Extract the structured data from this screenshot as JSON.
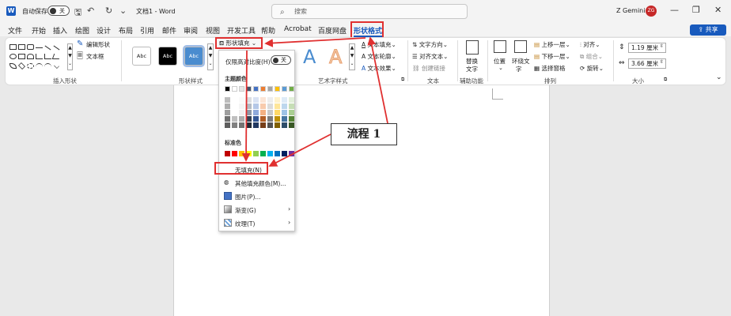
{
  "titlebar": {
    "logo": "W",
    "autosave_label": "自动保存",
    "autosave_state": "关",
    "doc_title": "文档1 - Word",
    "search_placeholder": "搜索",
    "user_name": "Z Gemini",
    "user_initials": "ZG",
    "icons": [
      "save-icon",
      "undo-icon",
      "redo-icon",
      "customize-icon"
    ]
  },
  "tabs": [
    "文件",
    "开始",
    "插入",
    "绘图",
    "设计",
    "布局",
    "引用",
    "邮件",
    "审阅",
    "视图",
    "开发工具",
    "帮助",
    "Acrobat",
    "百度网盘",
    "形状格式"
  ],
  "active_tab": "形状格式",
  "share_label": "共享",
  "ribbon": {
    "insert_shapes": {
      "label": "插入形状",
      "edit_shape": "编辑形状",
      "text_box": "文本框"
    },
    "shape_styles": {
      "label": "形状样式",
      "swatch_text": "Abc",
      "fill": "形状填充"
    },
    "wordart": {
      "label": "艺术字样式",
      "text_fill": "文本填充",
      "text_outline": "文本轮廓",
      "text_effects": "文本效果",
      "glyph": "A"
    },
    "text": {
      "label": "文本",
      "text_direction": "文字方向",
      "align_text": "对齐文本",
      "create_link": "创建链接"
    },
    "accessibility": {
      "label": "辅助功能",
      "alt_text_line1": "替换",
      "alt_text_line2": "文字"
    },
    "arrange": {
      "label": "排列",
      "position": "位置",
      "wrap_line1": "环绕文",
      "wrap_line2": "字",
      "bring_forward": "上移一层",
      "send_backward": "下移一层",
      "selection_pane": "选择窗格",
      "align": "对齐",
      "group": "组合",
      "rotate": "旋转"
    },
    "size": {
      "label": "大小",
      "height": "1.19 厘米",
      "width": "3.66 厘米"
    }
  },
  "dropdown": {
    "high_contrast_label": "仅限高对比度(H)",
    "high_contrast_state": "关",
    "theme_colors_header": "主题颜色",
    "standard_colors_header": "标准色",
    "no_fill": "无填充(N)",
    "more_colors": "其他填充颜色(M)...",
    "picture": "图片(P)...",
    "gradient": "渐变(G)",
    "texture": "纹理(T)"
  },
  "theme_colors_top": [
    "#000000",
    "#ffffff",
    "#e7e6e6",
    "#44546a",
    "#4472c4",
    "#ed7d31",
    "#a5a5a5",
    "#ffc000",
    "#5b9bd5",
    "#70ad47"
  ],
  "standard_colors": [
    "#c00000",
    "#ff0000",
    "#ffc000",
    "#ffff00",
    "#92d050",
    "#00b050",
    "#00b0f0",
    "#0070c0",
    "#002060",
    "#7030a0"
  ],
  "callout_text": "流程 1",
  "colors": {
    "accent": "#185abd",
    "annotation": "#e03030"
  }
}
